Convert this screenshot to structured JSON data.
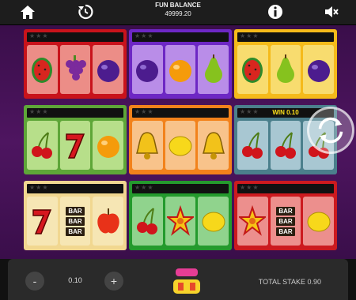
{
  "header": {
    "balance_label": "FUN BALANCE",
    "balance_value": "49999.20",
    "icons": [
      "home-icon",
      "history-icon",
      "info-icon",
      "mute-icon"
    ]
  },
  "machines": [
    {
      "color": "red",
      "stars": "★★★",
      "win": "",
      "symbols": [
        "watermelon",
        "grapes",
        "plum"
      ]
    },
    {
      "color": "violet",
      "stars": "★★★",
      "win": "",
      "symbols": [
        "plum",
        "orange",
        "pear"
      ]
    },
    {
      "color": "yel",
      "stars": "★★★",
      "win": "",
      "symbols": [
        "watermelon",
        "pear",
        "plum"
      ]
    },
    {
      "color": "grn",
      "stars": "★★★",
      "win": "",
      "symbols": [
        "cherry",
        "seven",
        "orange"
      ]
    },
    {
      "color": "ora",
      "stars": "★★★",
      "win": "",
      "symbols": [
        "bell",
        "lemon",
        "bell"
      ]
    },
    {
      "color": "teal",
      "stars": "★★★",
      "win": "WIN 0.10",
      "symbols": [
        "cherry",
        "cherry",
        "cherry"
      ]
    },
    {
      "color": "cream",
      "stars": "★★★",
      "win": "",
      "symbols": [
        "seven",
        "bar",
        "apple"
      ]
    },
    {
      "color": "dgrn",
      "stars": "★★★",
      "win": "",
      "symbols": [
        "cherry",
        "star",
        "lemon"
      ]
    },
    {
      "color": "cred",
      "stars": "★★★",
      "win": "",
      "symbols": [
        "star",
        "bar",
        "lemon"
      ]
    }
  ],
  "bar_text": [
    "BAR",
    "BAR",
    "BAR"
  ],
  "footer": {
    "minus": "-",
    "plus": "+",
    "bet": "0.10",
    "total_stake": "TOTAL STAKE 0.90",
    "logo_icon": "fruity-3x3-logo"
  }
}
